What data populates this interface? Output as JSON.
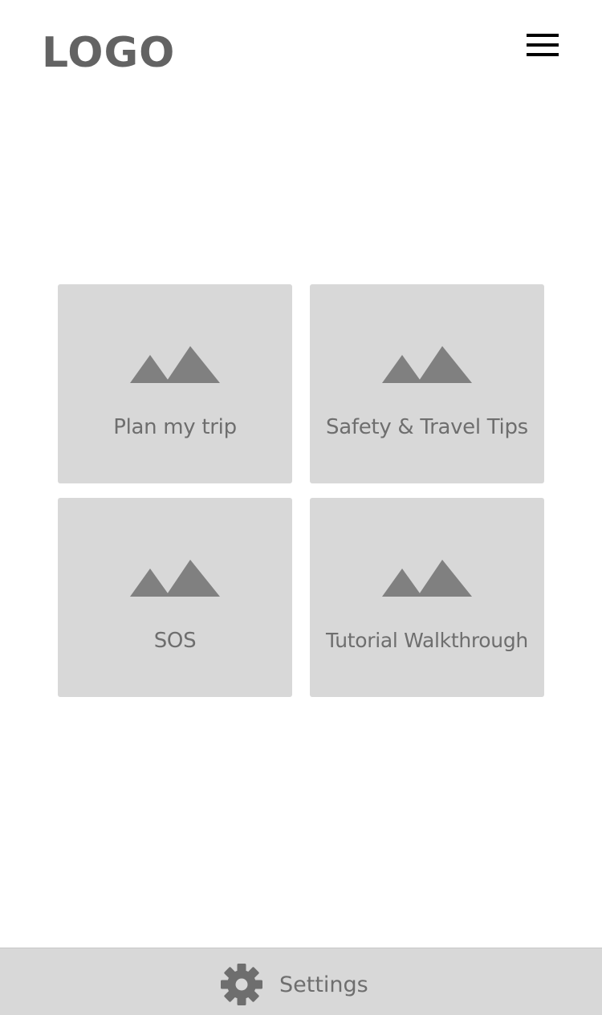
{
  "header": {
    "logo_text": "LOGO",
    "menu_icon": "hamburger-menu-icon"
  },
  "tiles": [
    {
      "label": "Plan my trip",
      "icon": "image-placeholder-icon"
    },
    {
      "label": "Safety & Travel Tips",
      "icon": "image-placeholder-icon"
    },
    {
      "label": "SOS",
      "icon": "image-placeholder-icon"
    },
    {
      "label": "Tutorial Walkthrough",
      "icon": "image-placeholder-icon"
    }
  ],
  "bottom_bar": {
    "settings_label": "Settings",
    "settings_icon": "gear-icon"
  },
  "colors": {
    "tile_background": "#d8d8d8",
    "icon_fill": "#808080",
    "text": "#6e6e6e",
    "logo": "#636363"
  }
}
